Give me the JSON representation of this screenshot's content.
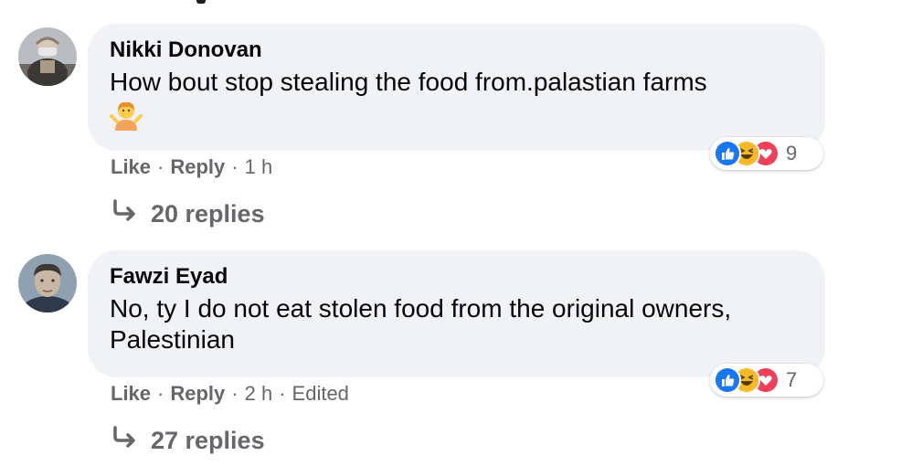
{
  "comments": [
    {
      "author": "Nikki Donovan",
      "text": "How bout stop stealing the food from.palastian farms",
      "emoji": "🤷",
      "reaction_count": "9",
      "reactions": [
        "like-icon",
        "haha-icon",
        "love-icon"
      ],
      "like_label": "Like",
      "reply_label": "Reply",
      "time": "1 h",
      "edited": "",
      "replies_label": "20 replies"
    },
    {
      "author": "Fawzi Eyad",
      "text_line1": "No, ty I do not eat stolen food from the original owners,",
      "text_line2": "Palestinian",
      "reaction_count": "7",
      "reactions": [
        "like-icon",
        "haha-icon",
        "love-icon"
      ],
      "like_label": "Like",
      "reply_label": "Reply",
      "time": "2 h",
      "edited": "Edited",
      "replies_label": "27 replies"
    }
  ],
  "separator": "·",
  "colors": {
    "bubble": "#f0f2f5",
    "meta_text": "#65676b",
    "like_blue": "#1877f2",
    "haha_yellow": "#f7b928",
    "love_red": "#f33e58"
  }
}
